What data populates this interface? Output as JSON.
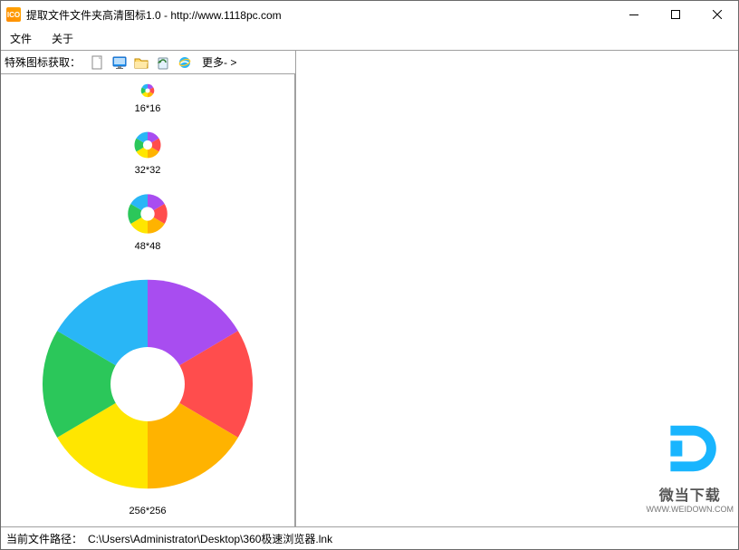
{
  "titlebar": {
    "title": "提取文件文件夹高清图标1.0 - http://www.1118pc.com"
  },
  "menu": {
    "file": "文件",
    "about": "关于"
  },
  "toolbar": {
    "label": "特殊图标获取：",
    "more": "更多- >"
  },
  "sizes": {
    "s16": "16*16",
    "s32": "32*32",
    "s48": "48*48",
    "s256": "256*256"
  },
  "status": {
    "path_label": "当前文件路径：",
    "path": "C:\\Users\\Administrator\\Desktop\\360极速浏览器.lnk"
  },
  "watermark": {
    "line1": "微当下载",
    "line2": "WWW.WEIDOWN.COM"
  }
}
